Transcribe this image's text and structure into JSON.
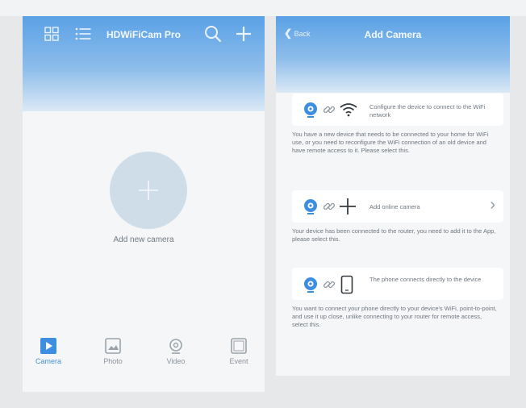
{
  "main_screen": {
    "app_title": "HDWiFiCam Pro",
    "add_camera_label": "Add new camera",
    "tabs": [
      {
        "label": "Camera",
        "icon": "play-icon",
        "active": true
      },
      {
        "label": "Photo",
        "icon": "photo-icon",
        "active": false
      },
      {
        "label": "Video",
        "icon": "video-icon",
        "active": false
      },
      {
        "label": "Event",
        "icon": "event-icon",
        "active": false
      }
    ]
  },
  "add_camera_screen": {
    "back_label": "Back",
    "title": "Add Camera",
    "options": [
      {
        "card_text": "Configure the device to connect to the WiFi network",
        "description": "You have a new device that needs to be connected to your home for WiFi use, or you need to reconfigure the WiFi connection of an old device and have remote access to it. Please select this.",
        "icon": "wifi-icon"
      },
      {
        "card_text": "Add online camera",
        "description": "Your device has been connected to the router, you need to add it to the App, please select this.",
        "icon": "plus-icon"
      },
      {
        "card_text": "The phone connects directly to the device",
        "description": "You want to connect your phone directly to your device's WiFi, point-to-point, and use it up close, unlike connecting to your router for remote access, select this.",
        "icon": "phone-icon"
      }
    ]
  },
  "colors": {
    "header_blue": "#5aa1e6",
    "accent": "#4a90d9",
    "camera_icon_blue": "#3d8ee0"
  }
}
